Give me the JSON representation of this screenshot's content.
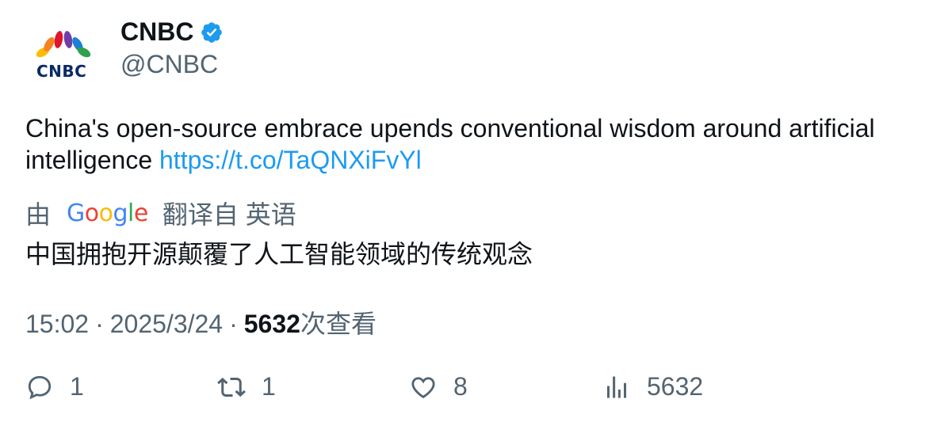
{
  "author": {
    "avatar_text": "CNBC",
    "display_name": "CNBC",
    "handle": "@CNBC",
    "verified": true
  },
  "tweet": {
    "text": "China's open-source embrace upends conventional wisdom around artificial intelligence ",
    "link": "https://t.co/TaQNXiFvYl"
  },
  "translation": {
    "prefix": "由",
    "provider_letters": [
      "G",
      "o",
      "o",
      "g",
      "l",
      "e"
    ],
    "suffix": "翻译自 英语",
    "text": "中国拥抱开源颠覆了人工智能领域的传统观念"
  },
  "meta": {
    "time": "15:02",
    "date": "2025/3/24",
    "views_count": "5632",
    "views_label": "次查看"
  },
  "actions": {
    "replies": "1",
    "reposts": "1",
    "likes": "8",
    "views": "5632"
  },
  "colors": {
    "link": "#1d9bf0",
    "secondary_text": "#536471",
    "verified_badge": "#1d9bf0"
  }
}
